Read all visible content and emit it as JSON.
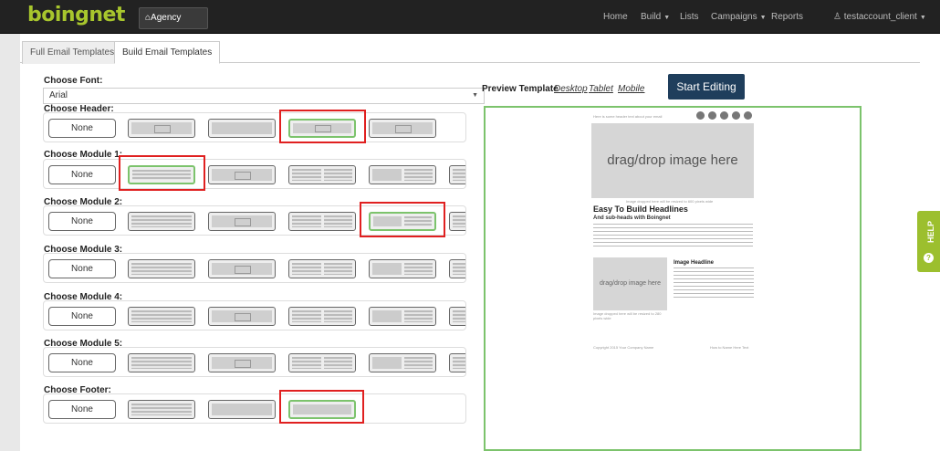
{
  "app": {
    "logo": "boingnet",
    "agency_label": "Agency Home"
  },
  "nav": {
    "items": [
      "Home",
      "Build",
      "Lists",
      "Campaigns",
      "Reports"
    ],
    "user": "testaccount_client"
  },
  "tabs": [
    "Full Email Templates",
    "Build Email Templates"
  ],
  "font": {
    "label": "Choose Font:",
    "value": "Arial"
  },
  "sections": {
    "header": "Choose Header:",
    "m1": "Choose Module 1:",
    "m2": "Choose Module 2:",
    "m3": "Choose Module 3:",
    "m4": "Choose Module 4:",
    "m5": "Choose Module 5:",
    "footer": "Choose Footer:"
  },
  "none_label": "None",
  "preview": {
    "label": "Preview Template",
    "links": [
      "Desktop",
      "Tablet",
      "Mobile"
    ],
    "start": "Start Editing",
    "header_text": "Here is some header text about your email",
    "dragdrop": "drag/drop image here",
    "caption": "Image dropped here will be resized to 600 pixels wide",
    "headline": "Easy To Build Headlines",
    "subhead": "And sub-heads with Boingnet",
    "image_headline": "Image Headline",
    "image_caption": "Image dropped here will be resized to 280 pixels wide",
    "footer_copy": "Copyright 2015 Your Company Name",
    "footer_link": "How to Name Here Text"
  },
  "help": "HELP",
  "colors": {
    "accent": "#7cc36c",
    "highlight": "#e02020",
    "brand": "#a8c62d",
    "button": "#1f3e5c"
  }
}
